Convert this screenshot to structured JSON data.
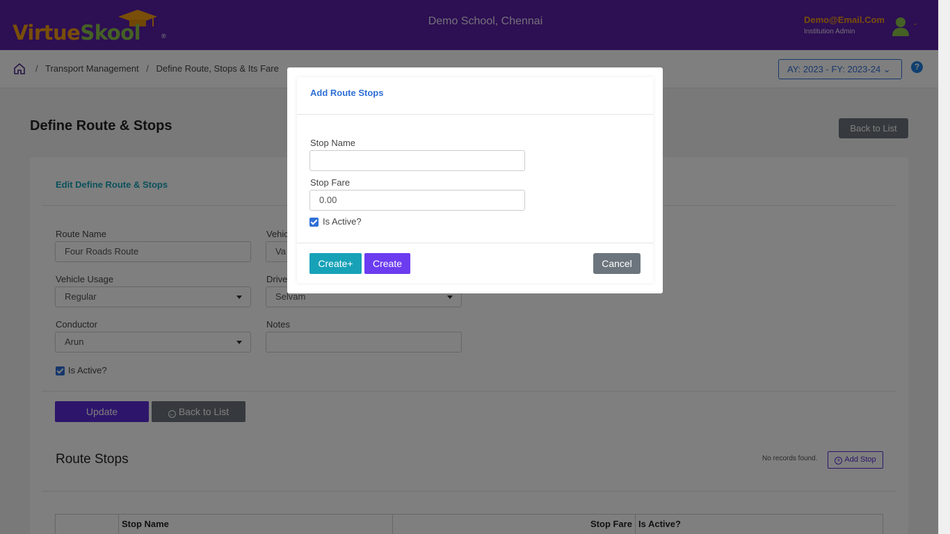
{
  "header": {
    "logo": {
      "part1": "Virtue",
      "part2": "Skool",
      "reg": "®"
    },
    "school": "Demo School, Chennai",
    "user_email": "Demo@Email.Com",
    "user_role": "Institution Admin",
    "caret": "⌄"
  },
  "breadcrumb": {
    "items": [
      "Transport Management",
      "Define Route, Stops & Its Fare"
    ],
    "separator": "/"
  },
  "academic_year": "AY: 2023 - FY: 2023-24 ⌄",
  "help_label": "?",
  "page": {
    "title": "Define Route & Stops",
    "back_top_label": "Back to List"
  },
  "form": {
    "title": "Edit Define Route & Stops",
    "route_name_label": "Route Name",
    "route_name_value": "Four Roads Route",
    "vehicle_label": "Vehic",
    "vehicle_value": "Va",
    "vehicle_usage_label": "Vehicle Usage",
    "vehicle_usage_value": "Regular",
    "driver_label": "Drive",
    "driver_value": "Selvam",
    "conductor_label": "Conductor",
    "conductor_value": "Arun",
    "notes_label": "Notes",
    "notes_value": "",
    "is_active_label": "Is Active?",
    "update_label": "Update",
    "back_label": "Back to List"
  },
  "route_stops": {
    "title": "Route Stops",
    "empty_text": "No records found.",
    "add_label": "Add Stop",
    "columns": [
      "Stop Name",
      "Stop Fare",
      "Is Active?"
    ]
  },
  "modal": {
    "title": "Add Route Stops",
    "stop_name_label": "Stop Name",
    "stop_name_value": "",
    "stop_fare_label": "Stop Fare",
    "stop_fare_value": "0.00",
    "is_active_label": "Is Active?",
    "create_plus_label": "Create+",
    "create_label": "Create",
    "cancel_label": "Cancel"
  },
  "colors": {
    "header_bg": "#5b1fa6",
    "accent_orange": "#f39c12",
    "accent_green": "#8bc34a",
    "primary": "#5b2bd6",
    "info": "#17a2b8",
    "secondary": "#6c757d",
    "link_blue": "#2f6fd6"
  }
}
